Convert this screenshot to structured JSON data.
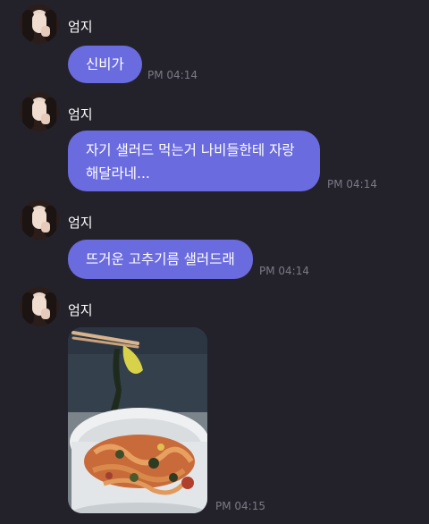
{
  "messages": [
    {
      "sender": "엄지",
      "text": "신비가",
      "time": "PM 04:14"
    },
    {
      "sender": "엄지",
      "text_lines": [
        "자기 샐러드 먹는거 나비들한테 자랑",
        "해달라네..."
      ],
      "time": "PM 04:14"
    },
    {
      "sender": "엄지",
      "text": "뜨거운 고추기름 샐러드래",
      "time": "PM 04:14"
    },
    {
      "sender": "엄지",
      "image": "photo-salad-with-chopsticks",
      "time": "PM 04:15"
    }
  ],
  "colors": {
    "background": "#23222b",
    "bubble": "#6b6be0",
    "timestamp": "#7b7a85"
  }
}
